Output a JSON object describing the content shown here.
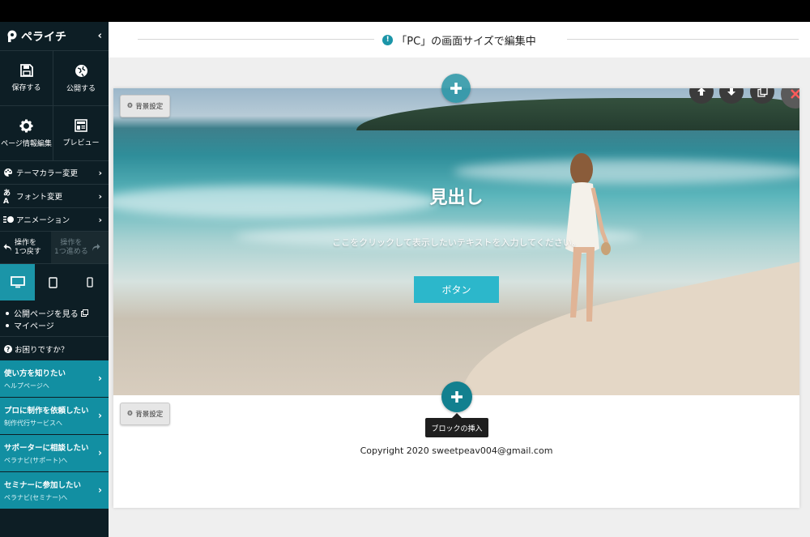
{
  "app": {
    "name": "ペライチ",
    "mode_label": "「PC」の画面サイズで編集中",
    "info_mark": "!"
  },
  "sidebar": {
    "actions": [
      {
        "label": "保存する",
        "icon": "save-icon"
      },
      {
        "label": "公開する",
        "icon": "publish-icon"
      },
      {
        "label": "ページ情報編集",
        "icon": "gear-icon"
      },
      {
        "label": "プレビュー",
        "icon": "preview-icon"
      }
    ],
    "menu": [
      {
        "label": "テーマカラー変更",
        "icon": "palette-icon"
      },
      {
        "label": "フォント変更",
        "icon": "font-icon"
      },
      {
        "label": "アニメーション",
        "icon": "animation-icon"
      }
    ],
    "undo": {
      "line1": "操作を",
      "line2": "1つ戻す"
    },
    "redo": {
      "line1": "操作を",
      "line2": "1つ進める"
    },
    "devices": [
      "desktop",
      "tablet",
      "mobile"
    ],
    "links": [
      "公開ページを見る",
      "マイページ"
    ],
    "help": "お困りですか？",
    "promos": [
      {
        "title": "使い方を知りたい",
        "sub": "ヘルプページへ"
      },
      {
        "title": "プロに制作を依頼したい",
        "sub": "制作代行サービスへ"
      },
      {
        "title": "サポーターに相談したい",
        "sub": "ペラナビ(サポート)へ"
      },
      {
        "title": "セミナーに参加したい",
        "sub": "ペラナビ(セミナー)へ"
      }
    ]
  },
  "editor": {
    "bg_setting_label": "背景設定",
    "hero_title": "見出し",
    "hero_text": "ここをクリックして表示したいテキストを入力してください。",
    "hero_button": "ボタン",
    "insert_tooltip": "ブロックの挿入",
    "copyright": "Copyright 2020 sweetpeav004@gmail.com"
  },
  "colors": {
    "accent": "#1b95a8",
    "sidebar_bg": "#0d1e25",
    "promo_bg": "#128fa2",
    "hero_button_bg": "#2cb7cb"
  }
}
